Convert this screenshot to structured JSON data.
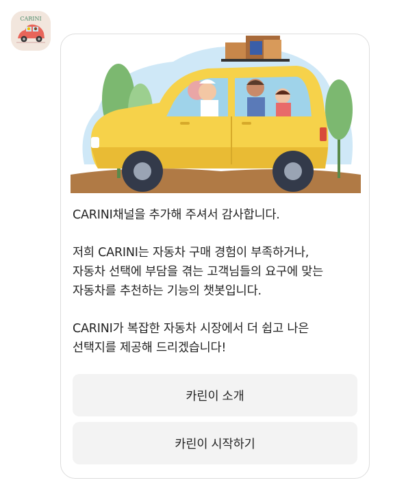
{
  "avatar": {
    "logo_text": "CARINI"
  },
  "message": {
    "paragraph1": [
      "CARINI채널을 추가해 주셔서 감사합니다."
    ],
    "paragraph2": [
      "저희 CARINI는 자동차 구매 경험이 부족하거나,",
      "자동차 선택에 부담을 겪는 고객님들의 요구에 맞는",
      "자동차를 추천하는 기능의 챗봇입니다."
    ],
    "paragraph3": [
      "CARINI가 복잡한 자동차 시장에서 더 쉽고 나은",
      "선택지를 제공해 드리겠습니다!"
    ]
  },
  "buttons": {
    "intro_label": "카린이 소개",
    "start_label": "카린이 시작하기"
  },
  "colors": {
    "car_body": "#f6d24a",
    "sky": "#cfe8f7",
    "ground": "#b07a45",
    "tree": "#7cb870"
  }
}
